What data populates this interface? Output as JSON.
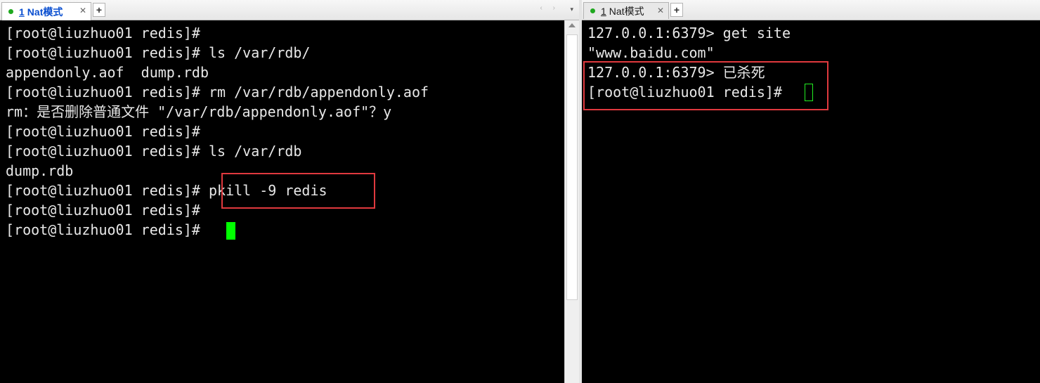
{
  "left_tab": {
    "number": "1",
    "title": "Nat模式",
    "close_glyph": "✕",
    "status_color": "#1fa81f"
  },
  "right_tab": {
    "number": "1",
    "title": "Nat模式",
    "close_glyph": "✕",
    "status_color": "#1fa81f"
  },
  "new_tab_glyph": "+",
  "nav_arrows": "‹ ›",
  "tab_menu_glyph": "▾",
  "left_terminal": {
    "lines": [
      "[root@liuzhuo01 redis]#",
      "[root@liuzhuo01 redis]# ls /var/rdb/",
      "appendonly.aof  dump.rdb",
      "[root@liuzhuo01 redis]# rm /var/rdb/appendonly.aof",
      "rm：是否删除普通文件 \"/var/rdb/appendonly.aof\"？y",
      "[root@liuzhuo01 redis]#",
      "[root@liuzhuo01 redis]# ls /var/rdb",
      "dump.rdb",
      "[root@liuzhuo01 redis]# pkill -9 redis",
      "[root@liuzhuo01 redis]#",
      "[root@liuzhuo01 redis]# "
    ],
    "cursor_color": "#00ff00"
  },
  "right_terminal": {
    "lines": [
      "127.0.0.1:6379> get site",
      "\"www.baidu.com\"",
      "127.0.0.1:6379> 已杀死",
      "[root@liuzhuo01 redis]# "
    ],
    "cursor_color": "#22ee22"
  },
  "colors": {
    "terminal_bg": "#000000",
    "terminal_fg": "#e8e8e8",
    "highlight": "#e0393e",
    "active_tab_text": "#0a4fd0"
  }
}
